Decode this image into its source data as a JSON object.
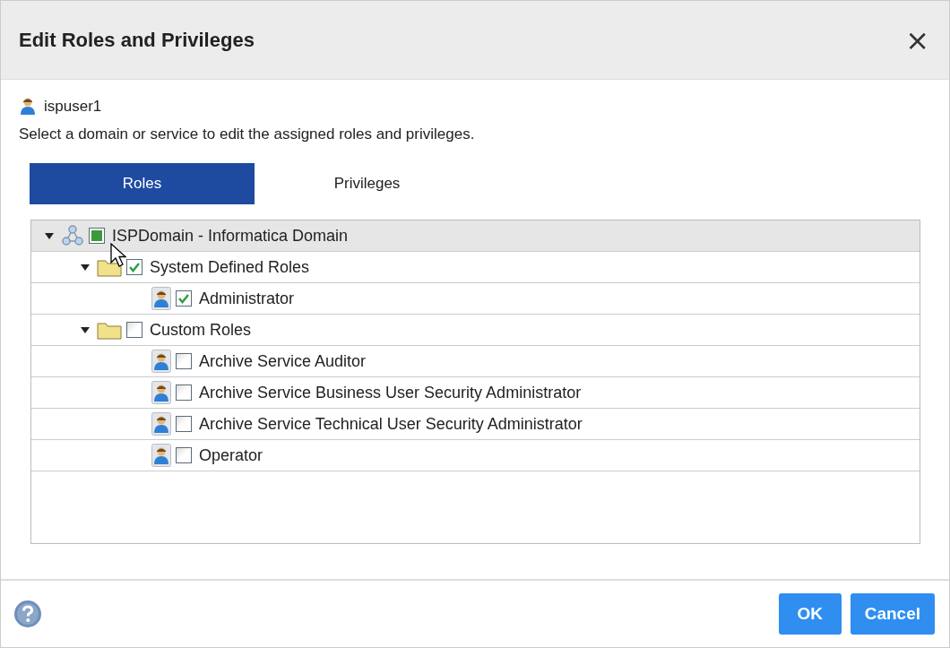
{
  "window": {
    "title": "Edit Roles and Privileges",
    "close": "×"
  },
  "user": {
    "name": "ispuser1"
  },
  "instruction": "Select a domain or service to edit the assigned roles and privileges.",
  "tabs": [
    {
      "label": "Roles",
      "selected": true
    },
    {
      "label": "Privileges",
      "selected": false
    }
  ],
  "tree": [
    {
      "kind": "domain",
      "label": "ISPDomain - Informatica Domain",
      "expanded": true,
      "checked": false,
      "partial": true,
      "selected": true,
      "children": [
        {
          "kind": "folder",
          "label": "System Defined Roles",
          "expanded": true,
          "checked": true,
          "selected": false,
          "children": [
            {
              "kind": "role",
              "label": "Administrator",
              "checked": true,
              "selected": false
            }
          ]
        },
        {
          "kind": "folder",
          "label": "Custom Roles",
          "expanded": true,
          "checked": false,
          "selected": false,
          "children": [
            {
              "kind": "role",
              "label": "Archive Service Auditor",
              "checked": false,
              "selected": false
            },
            {
              "kind": "role",
              "label": "Archive Service Business User Security Administrator",
              "checked": false,
              "selected": false
            },
            {
              "kind": "role",
              "label": "Archive Service Technical User Security Administrator",
              "checked": false,
              "selected": false
            },
            {
              "kind": "role",
              "label": "Operator",
              "checked": false,
              "selected": false
            }
          ]
        }
      ]
    }
  ],
  "buttons": [
    {
      "label": "OK"
    },
    {
      "label": "Cancel"
    }
  ]
}
